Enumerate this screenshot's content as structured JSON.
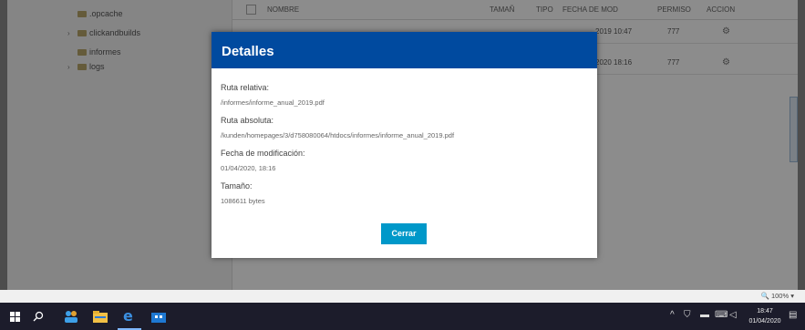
{
  "sidebar": {
    "items": [
      {
        "label": ".opcache",
        "caret": ""
      },
      {
        "label": "clickandbuilds",
        "caret": "›"
      },
      {
        "label": "informes",
        "caret": ""
      },
      {
        "label": "logs",
        "caret": "›"
      }
    ]
  },
  "table": {
    "headers": [
      "NOMBRE",
      "TAMAÑ",
      "TIPO",
      "FECHA DE MOD",
      "PERMISO",
      "ACCION"
    ],
    "rows": [
      {
        "date": "2019 10:47",
        "perms": "777"
      },
      {
        "date": "2020 18:16",
        "perms": "777"
      }
    ]
  },
  "modal": {
    "title": "Detalles",
    "fields": [
      {
        "label": "Ruta relativa:",
        "value": "/informes/informe_anual_2019.pdf"
      },
      {
        "label": "Ruta absoluta:",
        "value": "/kunden/homepages/3/d758080064/htdocs/informes/informe_anual_2019.pdf"
      },
      {
        "label": "Fecha de modificación:",
        "value": "01/04/2020, 18:16"
      },
      {
        "label": "Tamaño:",
        "value": "1086611 bytes"
      }
    ],
    "close_label": "Cerrar"
  },
  "zoom": {
    "label": "🔍 100%  ▾"
  },
  "taskbar": {
    "time": "18:47",
    "date": "01/04/2020",
    "icons": [
      "windows-start-icon",
      "search-icon",
      "people-app-icon",
      "file-explorer-icon",
      "edge-browser-icon",
      "store-app-icon"
    ]
  },
  "colors": {
    "header": "#004a9f",
    "button": "#0098c9"
  }
}
